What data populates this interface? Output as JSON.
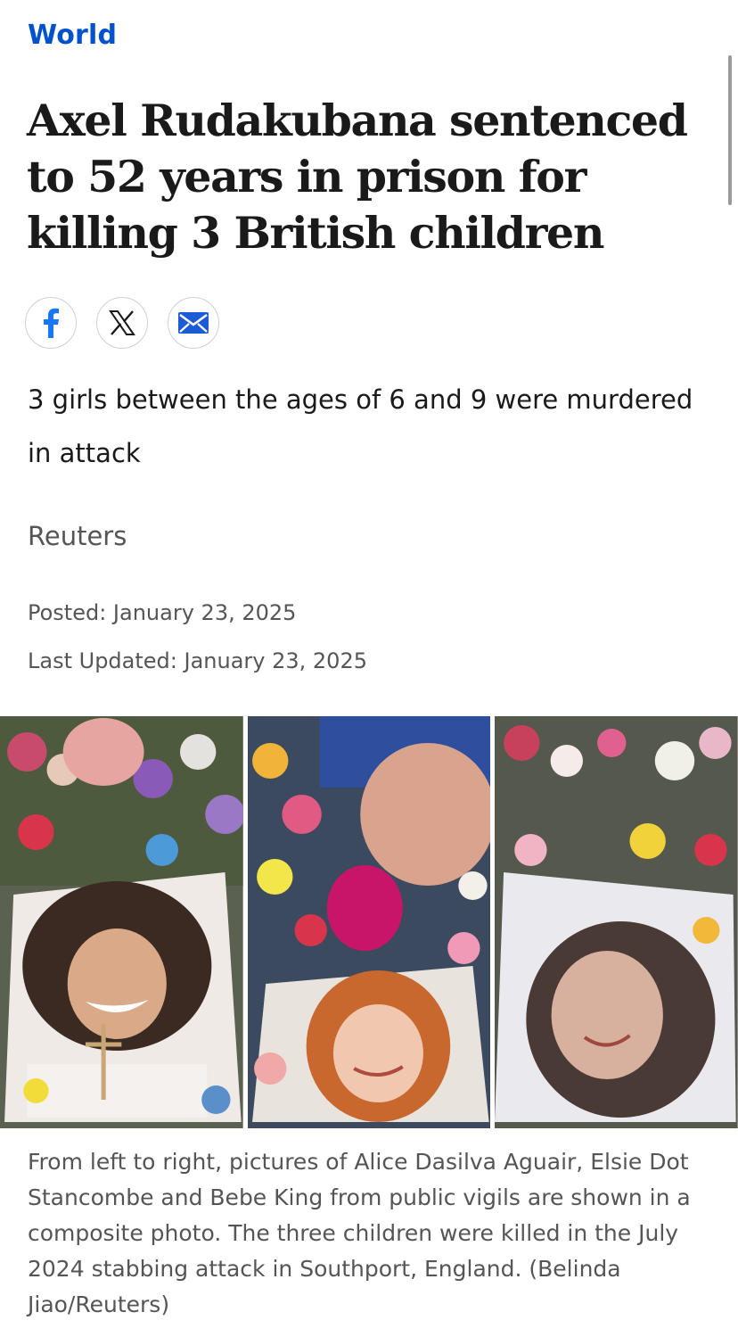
{
  "section": "World",
  "headline": "Axel Rudakubana sentenced to 52 years in prison for killing 3 British children",
  "share": {
    "facebook_icon": "facebook-icon",
    "x_icon": "x-logo-icon",
    "email_icon": "envelope-icon"
  },
  "deck": "3 girls between the ages of 6 and 9 were murdered in attack",
  "byline": "Reuters",
  "posted": "Posted: January 23, 2025",
  "last_updated": "Last Updated: January 23, 2025",
  "photo": {
    "caption": "From left to right, pictures of Alice Dasilva Aguair, Elsie Dot Stancombe and Bebe King from public vigils are shown in a composite photo. The three children were killed in the July 2024 stabbing attack in Southport, England. (Belinda Jiao/Reuters)"
  },
  "colors": {
    "section_link": "#0052cc",
    "text": "#1a1a1a",
    "meta": "#555555",
    "facebook": "#1877f2",
    "email": "#1b5bd6"
  }
}
